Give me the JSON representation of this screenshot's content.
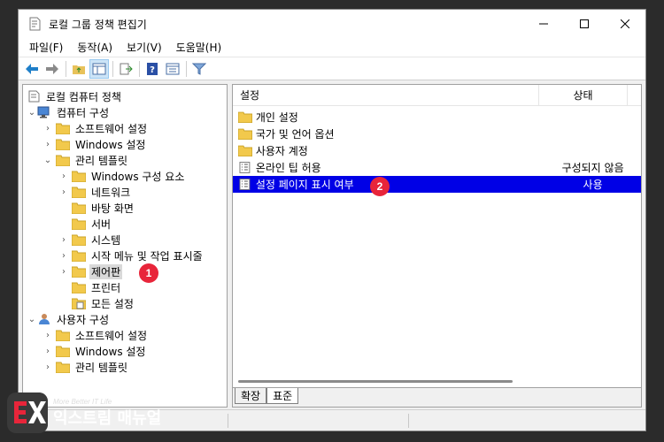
{
  "window": {
    "title": "로컬 그룹 정책 편집기"
  },
  "menu": [
    "파일(F)",
    "동작(A)",
    "보기(V)",
    "도움말(H)"
  ],
  "toolbar": {
    "buttons": [
      "back-arrow-icon",
      "forward-arrow-icon",
      "up-folder-icon",
      "show-hide-tree-icon",
      "export-list-icon",
      "help-icon",
      "properties-icon",
      "filter-icon"
    ]
  },
  "tree": {
    "root": "로컬 컴퓨터 정책",
    "computer_config": "컴퓨터 구성",
    "computer_software": "소프트웨어 설정",
    "computer_windows": "Windows 설정",
    "admin_templates": "관리 템플릿",
    "windows_components": "Windows 구성 요소",
    "network": "네트워크",
    "desktop": "바탕 화면",
    "server": "서버",
    "system": "시스템",
    "start_menu": "시작 메뉴 및 작업 표시줄",
    "control_panel": "제어판",
    "printers": "프린터",
    "all_settings": "모든 설정",
    "user_config": "사용자 구성",
    "user_software": "소프트웨어 설정",
    "user_windows": "Windows 설정",
    "user_admin": "관리 템플릿"
  },
  "list": {
    "col_setting": "설정",
    "col_state": "상태",
    "rows": [
      {
        "name": "개인 설정",
        "state": ""
      },
      {
        "name": "국가 및 언어 옵션",
        "state": ""
      },
      {
        "name": "사용자 계정",
        "state": ""
      },
      {
        "name": "온라인 팁 허용",
        "state": "구성되지 않음"
      },
      {
        "name": "설정 페이지 표시 여부",
        "state": "사용"
      }
    ]
  },
  "tabs": [
    "확장",
    "표준"
  ],
  "badges": [
    "1",
    "2"
  ],
  "watermark": {
    "tagline": "More Better IT Life",
    "brand": "익스트림 매뉴얼"
  },
  "colors": {
    "highlight": "#0000e6",
    "badge": "#e8253a"
  }
}
